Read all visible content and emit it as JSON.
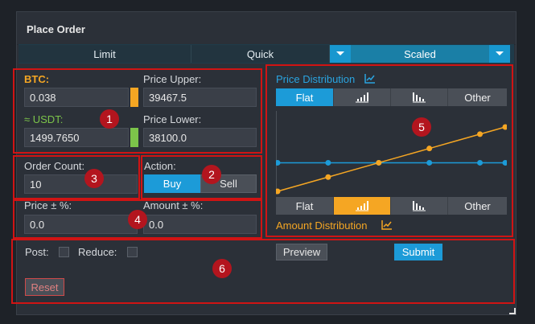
{
  "panel": {
    "title": "Place Order"
  },
  "tabs": [
    {
      "label": "Limit"
    },
    {
      "label": "Quick"
    },
    {
      "label": "Scaled"
    }
  ],
  "fields": {
    "btc": {
      "label": "BTC:",
      "value": "0.038"
    },
    "usdt": {
      "label": "≈ USDT:",
      "value": "1499.7650"
    },
    "price_upper": {
      "label": "Price Upper:",
      "value": "39467.5"
    },
    "price_lower": {
      "label": "Price Lower:",
      "value": "38100.0"
    },
    "order_count": {
      "label": "Order Count:",
      "value": "10"
    },
    "action": {
      "label": "Action:",
      "buy": "Buy",
      "sell": "Sell"
    },
    "price_pct": {
      "label": "Price ± %:",
      "value": "0.0"
    },
    "amount_pct": {
      "label": "Amount ± %:",
      "value": "0.0"
    }
  },
  "price_distribution": {
    "label": "Price Distribution",
    "options": [
      "Flat",
      "",
      "",
      "Other"
    ],
    "selected": "Flat"
  },
  "amount_distribution": {
    "label": "Amount Distribution",
    "options": [
      "Flat",
      "",
      "",
      "Other"
    ],
    "selected": "ramp-up"
  },
  "footer": {
    "post": "Post:",
    "reduce": "Reduce:",
    "preview": "Preview",
    "submit": "Submit",
    "reset": "Reset"
  },
  "annotations": [
    "1",
    "2",
    "3",
    "4",
    "5",
    "6"
  ],
  "colors": {
    "accent": "#1c9bd8",
    "orange": "#f5a623",
    "green": "#7cc44a",
    "annotation_red": "#d01414"
  },
  "chart_data": {
    "type": "line",
    "series": [
      {
        "values": [
          5,
          5,
          5,
          5,
          5,
          5,
          5,
          5,
          5,
          5
        ]
      },
      {
        "values": [
          1,
          2,
          3,
          4,
          5,
          6,
          7,
          8,
          9,
          10
        ]
      }
    ]
  }
}
